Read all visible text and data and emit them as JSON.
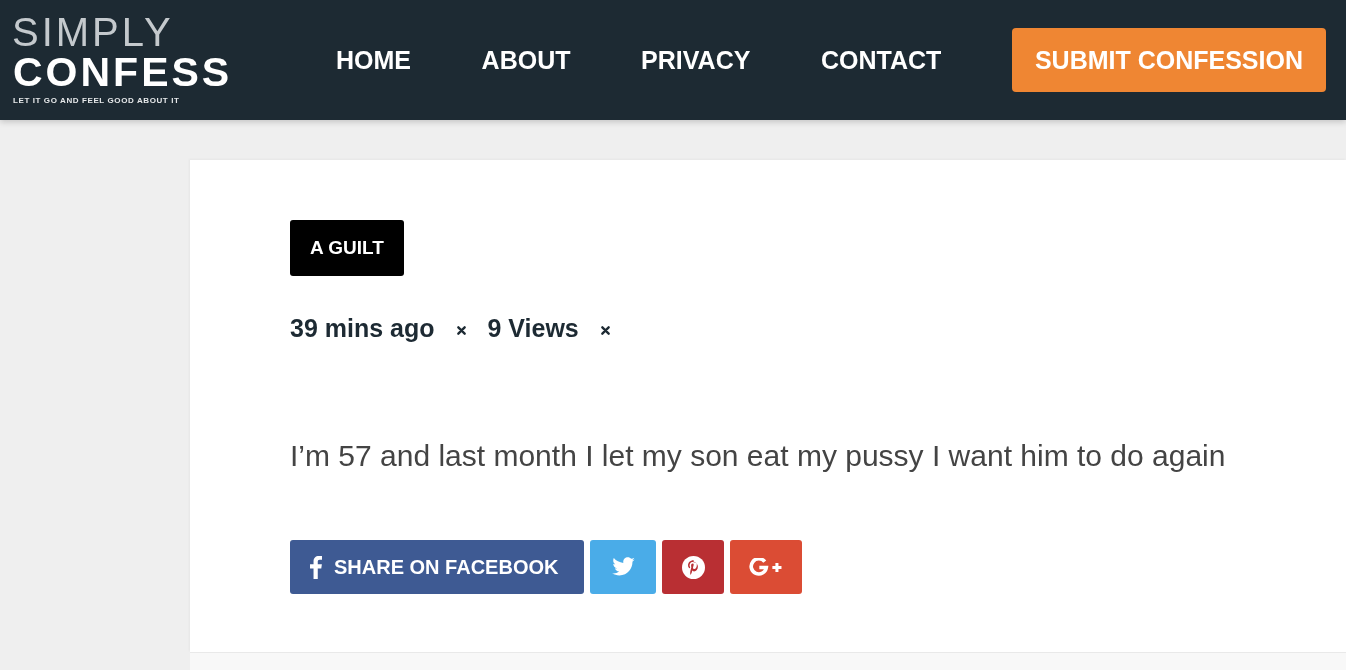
{
  "logo": {
    "line_1": "SIMPLY",
    "line_2": "CONFESS",
    "tagline": "LET IT GO AND FEEL GOOD ABOUT IT"
  },
  "nav": {
    "links": [
      {
        "label": "HOME",
        "kind": "link"
      },
      {
        "label": "ABOUT",
        "kind": "link"
      },
      {
        "label": "PRIVACY",
        "kind": "link"
      },
      {
        "label": "CONTACT",
        "kind": "link"
      },
      {
        "label": "SUBMIT CONFESSION",
        "kind": "button"
      }
    ]
  },
  "post": {
    "category": "A GUILT",
    "meta": [
      "39 mins ago",
      "9 Views"
    ],
    "body": "I’m 57 and last month I let my son eat my pussy I want him to do again",
    "share": [
      {
        "kind": "facebook",
        "label": "SHARE ON FACEBOOK"
      },
      {
        "kind": "twitter"
      },
      {
        "kind": "pinterest"
      },
      {
        "kind": "googleplus"
      }
    ]
  }
}
